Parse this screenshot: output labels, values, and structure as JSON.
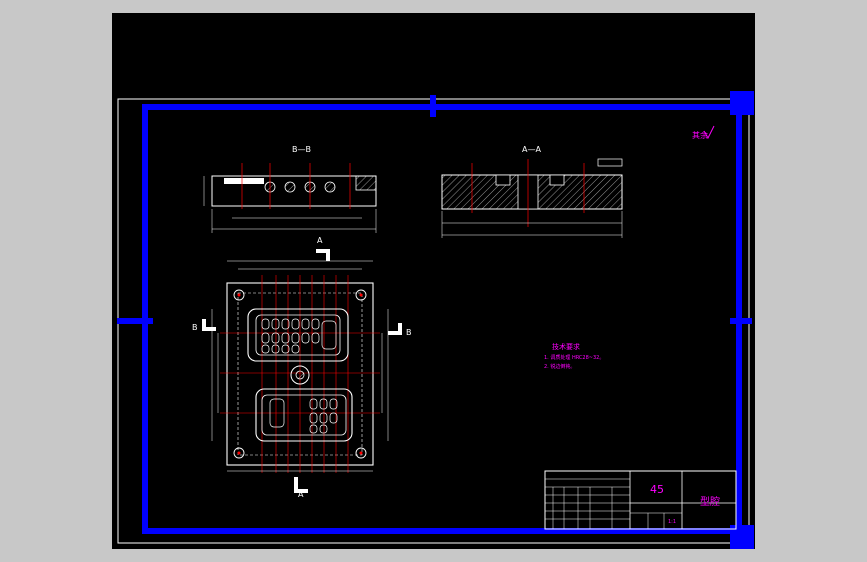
{
  "views": {
    "section_b": "B—B",
    "section_a": "A—A",
    "cut_a_top": "A",
    "cut_a_bottom": "A",
    "cut_b_left": "B",
    "cut_b_right": "B"
  },
  "surface_note": "其余",
  "tech_requirements": {
    "title": "技术要求",
    "lines": [
      "1. 调质处理 HRC28~32。",
      "2. 锐边倒钝。"
    ]
  },
  "title_block": {
    "material": "45",
    "part_name": "型腔",
    "scale": "1:1"
  },
  "colors": {
    "border": "#0000ff",
    "geometry": "#ffffff",
    "centerline": "#ff0000",
    "annotation": "#ff00ff",
    "background": "#000000"
  }
}
